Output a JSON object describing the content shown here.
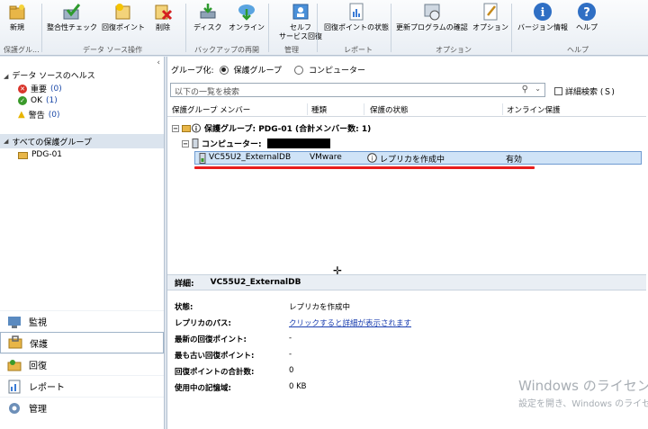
{
  "ribbon": {
    "buttons": [
      {
        "label": "新規",
        "icon": "new-folder-icon"
      },
      {
        "label": "整合性チェック",
        "icon": "consistency-check-icon"
      },
      {
        "label": "回復ポイント",
        "icon": "recovery-point-icon"
      },
      {
        "label": "削除",
        "icon": "delete-icon"
      },
      {
        "label": "ディスク",
        "icon": "disk-icon"
      },
      {
        "label": "オンライン",
        "icon": "online-icon"
      },
      {
        "label": "セルフ\nサービス回復",
        "icon": "self-service-recovery-icon"
      },
      {
        "label": "回復ポイントの状態",
        "icon": "recovery-point-status-icon"
      },
      {
        "label": "更新プログラムの確認",
        "icon": "update-check-icon"
      },
      {
        "label": "オプション",
        "icon": "options-icon"
      },
      {
        "label": "バージョン情報",
        "icon": "info-icon"
      },
      {
        "label": "ヘルプ",
        "icon": "help-icon"
      }
    ],
    "groups": [
      "保護グル...",
      "データ ソース操作",
      "バックアップの再開",
      "管理",
      "レポート",
      "オプション",
      "ヘルプ"
    ]
  },
  "left": {
    "health_title": "データ ソースのヘルス",
    "health": [
      {
        "label": "重要",
        "count": "(0)",
        "color": "#d9352b"
      },
      {
        "label": "OK",
        "count": "(1)",
        "color": "#3a9a2a"
      },
      {
        "label": "警告",
        "count": "(0)",
        "color": "#e8b400"
      }
    ],
    "all_groups": "すべての保護グループ",
    "group_item": "PDG-01",
    "nav": [
      "監視",
      "保護",
      "回復",
      "レポート",
      "管理"
    ],
    "active_nav": "保護"
  },
  "main": {
    "group_by_label": "グループ化:",
    "group_by_options": [
      "保護グループ",
      "コンピューター"
    ],
    "search_placeholder": "以下の一覧を検索",
    "detail_search_label": "詳細検索 (Ｓ)",
    "columns": [
      "保護グループ メンバー",
      "種類",
      "保護の状態",
      "オンライン保護"
    ],
    "group_row": "保護グループ: PDG-01 (合計メンバー数: 1)",
    "computer_row": "コンピューター:",
    "member": {
      "name": "VC55U2_ExternalDB",
      "type": "VMware",
      "status": "レプリカを作成中",
      "online": "有効"
    }
  },
  "details": {
    "label": "詳細:",
    "title": "VC55U2_ExternalDB",
    "rows": [
      {
        "label": "状態:",
        "value": "レプリカを作成中"
      },
      {
        "label": "レプリカのパス:",
        "value": "クリックすると詳細が表示されます"
      },
      {
        "label": "最新の回復ポイント:",
        "value": "-"
      },
      {
        "label": "最も古い回復ポイント:",
        "value": "-"
      },
      {
        "label": "回復ポイントの合計数:",
        "value": "0"
      },
      {
        "label": "使用中の記憶域:",
        "value": "0 KB"
      }
    ]
  },
  "watermark": {
    "line1": "Windows のライセンス認",
    "line2": "設定を開き、Windows のライセ"
  }
}
